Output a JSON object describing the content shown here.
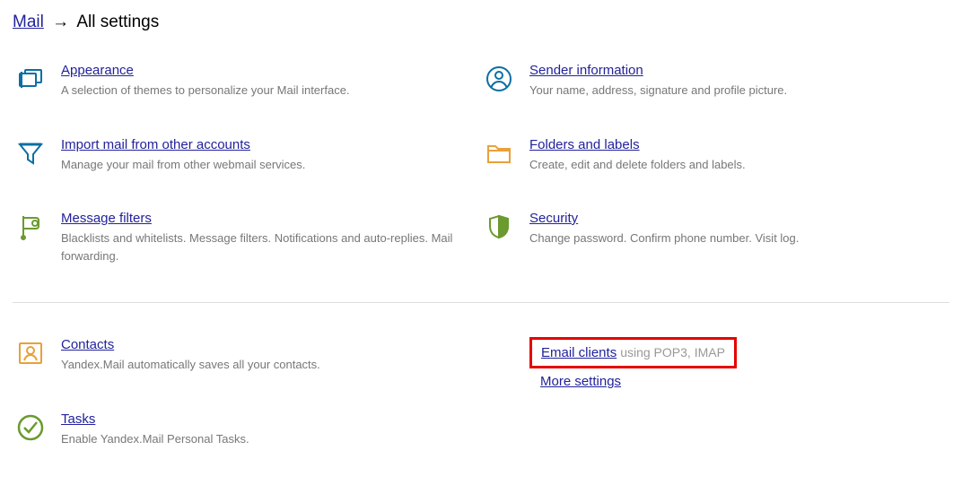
{
  "breadcrumb": {
    "root_label": "Mail",
    "arrow": "→",
    "current": "All settings"
  },
  "left": [
    {
      "title": "Appearance",
      "desc": "A selection of themes to personalize your Mail interface."
    },
    {
      "title": "Import mail from other accounts",
      "desc": "Manage your mail from other webmail services."
    },
    {
      "title": "Message filters",
      "desc": "Blacklists and whitelists. Message filters. Notifications and auto-replies. Mail forwarding."
    }
  ],
  "right": [
    {
      "title": "Sender information",
      "desc": "Your name, address, signature and profile picture."
    },
    {
      "title": "Folders and labels",
      "desc": "Create, edit and delete folders and labels."
    },
    {
      "title": "Security",
      "desc": "Change password. Confirm phone number. Visit log."
    }
  ],
  "bottom_left": [
    {
      "title": "Contacts",
      "desc": "Yandex.Mail automatically saves all your contacts."
    },
    {
      "title": "Tasks",
      "desc": "Enable Yandex.Mail Personal Tasks."
    }
  ],
  "email_clients": {
    "label": "Email clients",
    "suffix": "using POP3, IMAP",
    "more": "More settings"
  }
}
